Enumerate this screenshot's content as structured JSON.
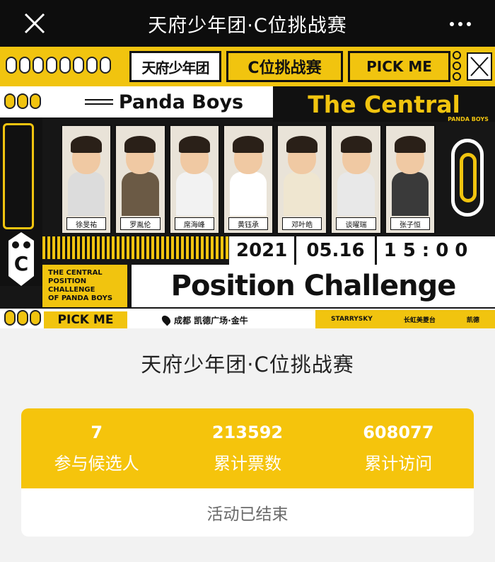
{
  "navbar": {
    "title": "天府少年团·C位挑战赛",
    "close_icon": "close-icon",
    "more_icon": "more-icon"
  },
  "banner": {
    "logo_text": "天府少年团",
    "c_title": "C位挑战赛",
    "pick_me_top": "PICK ME",
    "panda_boys": "Panda Boys",
    "the_central": "The Central",
    "panda_boys_small": "PANDA BOYS",
    "contestants": [
      {
        "name": "徐旻祐",
        "shirt": "#dcdcdc"
      },
      {
        "name": "罗胤伦",
        "shirt": "#6b5a45"
      },
      {
        "name": "席海峰",
        "shirt": "#f2f2f2"
      },
      {
        "name": "黄钰承",
        "shirt": "#ffffff"
      },
      {
        "name": "邓叶皓",
        "shirt": "#efe6d0"
      },
      {
        "name": "谈曜瑞",
        "shirt": "#e8e8e8"
      },
      {
        "name": "张子恒",
        "shirt": "#3a3a3a"
      }
    ],
    "date_year": "2021",
    "date_md": "05.16",
    "date_time": "15:00",
    "central_lines": [
      "THE CENTRAL",
      "POSITION CHALLENGE",
      "OF PANDA BOYS"
    ],
    "position_challenge": "Position Challenge",
    "pick_me_bottom": "PICK ME",
    "location": "成都 凯德广场·金牛",
    "sponsors": [
      "STARRYSKY",
      "长虹美菱台",
      "凯德"
    ],
    "accent_color": "#f1c40f"
  },
  "page": {
    "title": "天府少年团·C位挑战赛"
  },
  "stats": {
    "items": [
      {
        "value": "7",
        "label": "参与候选人"
      },
      {
        "value": "213592",
        "label": "累计票数"
      },
      {
        "value": "608077",
        "label": "累计访问"
      }
    ],
    "status": "活动已结束",
    "card_color": "#f5c40c"
  }
}
